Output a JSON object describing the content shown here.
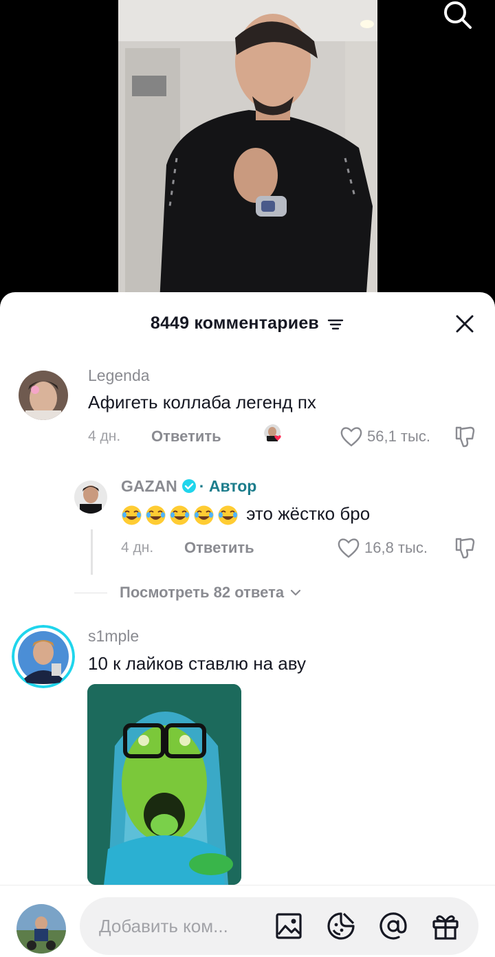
{
  "header": {
    "comment_count": "8449",
    "title_suffix": "комментариев"
  },
  "comments": [
    {
      "username": "Legenda",
      "text": "Афигеть коллаба легенд пх",
      "time": "4 дн.",
      "reply_label": "Ответить",
      "likes": "56,1 тыс.",
      "liked_by_creator": true
    },
    {
      "username": "GAZAN",
      "verified": true,
      "separator": "·",
      "author_label": "Автор",
      "emojis": "😂😂😂😂😂",
      "text": "это жёстко бро",
      "time": "4 дн.",
      "reply_label": "Ответить",
      "likes": "16,8 тыс."
    },
    {
      "username": "s1mple",
      "text": "10 к лайков ставлю на аву",
      "has_sticker": true
    }
  ],
  "view_replies": "Посмотреть 82 ответа",
  "input": {
    "placeholder": "Добавить ком..."
  },
  "icons": [
    "search-icon",
    "sort-icon",
    "close-icon",
    "heart-icon",
    "dislike-icon",
    "chevron-down-icon",
    "image-icon",
    "emoji-icon",
    "mention-icon",
    "gift-icon",
    "verified-icon"
  ],
  "colors": {
    "author_accent": "#1c7d8c",
    "verified": "#20d5ec",
    "muted_text": "#8a8b91",
    "primary_text": "#161823",
    "like_heart": "#fe2c55"
  }
}
